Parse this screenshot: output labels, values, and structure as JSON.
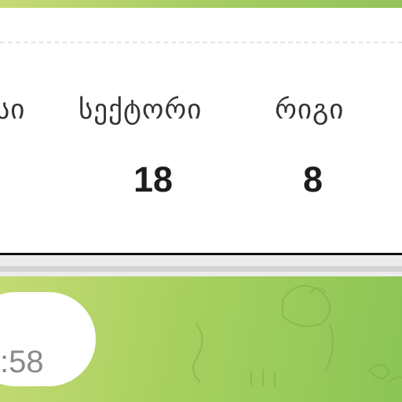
{
  "ticket": {
    "columns": [
      {
        "label": "სი",
        "value": ""
      },
      {
        "label": "სექტორი",
        "value": "18"
      },
      {
        "label": "რიგი",
        "value": "8"
      }
    ]
  },
  "clock": {
    "time": ":58"
  },
  "colors": {
    "card_background": "#ffffff",
    "card_border": "#111111",
    "value_text": "#1d1d1d",
    "label_text": "#333333",
    "background_green": "#a7d05f",
    "time_text": "#8a8a8a"
  }
}
